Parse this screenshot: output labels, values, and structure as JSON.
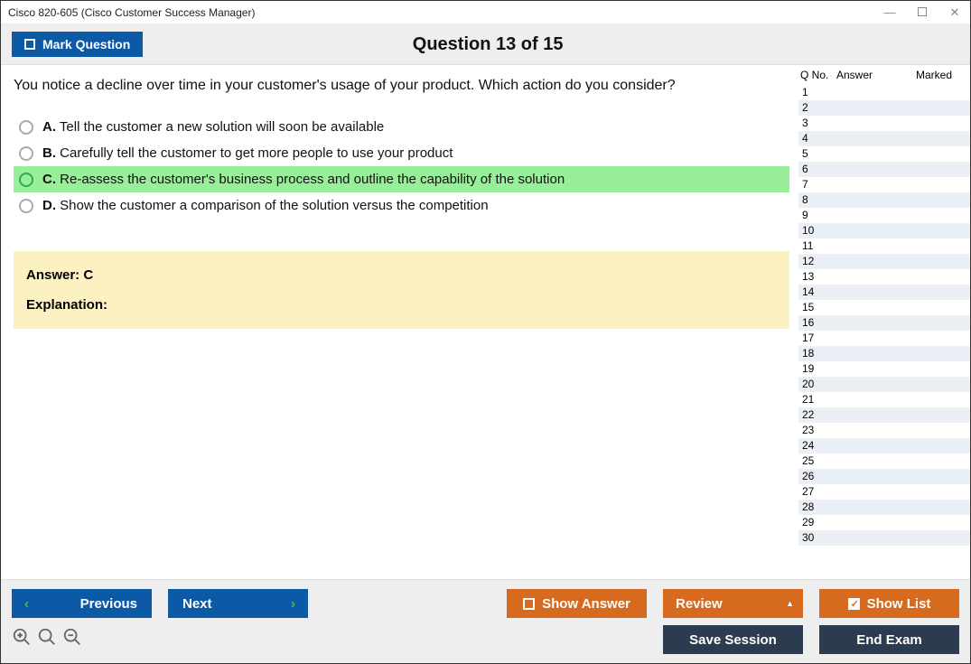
{
  "window": {
    "title": "Cisco 820-605 (Cisco Customer Success Manager)"
  },
  "header": {
    "mark_label": "Mark Question",
    "question_title": "Question 13 of 15"
  },
  "question": {
    "text": "You notice a decline over time in your customer's usage of your product. Which action do you consider?",
    "options": [
      {
        "letter": "A.",
        "text": "Tell the customer a new solution will soon be available",
        "correct": false
      },
      {
        "letter": "B.",
        "text": "Carefully tell the customer to get more people to use your product",
        "correct": false
      },
      {
        "letter": "C.",
        "text": "Re-assess the customer's business process and outline the capability of the solution",
        "correct": true
      },
      {
        "letter": "D.",
        "text": "Show the customer a comparison of the solution versus the competition",
        "correct": false
      }
    ],
    "answer_line": "Answer: C",
    "explanation_label": "Explanation:"
  },
  "side": {
    "col_qno": "Q No.",
    "col_answer": "Answer",
    "col_marked": "Marked",
    "rows": 30
  },
  "footer": {
    "previous": "Previous",
    "next": "Next",
    "show_answer": "Show Answer",
    "review": "Review",
    "show_list": "Show List",
    "save_session": "Save Session",
    "end_exam": "End Exam"
  }
}
